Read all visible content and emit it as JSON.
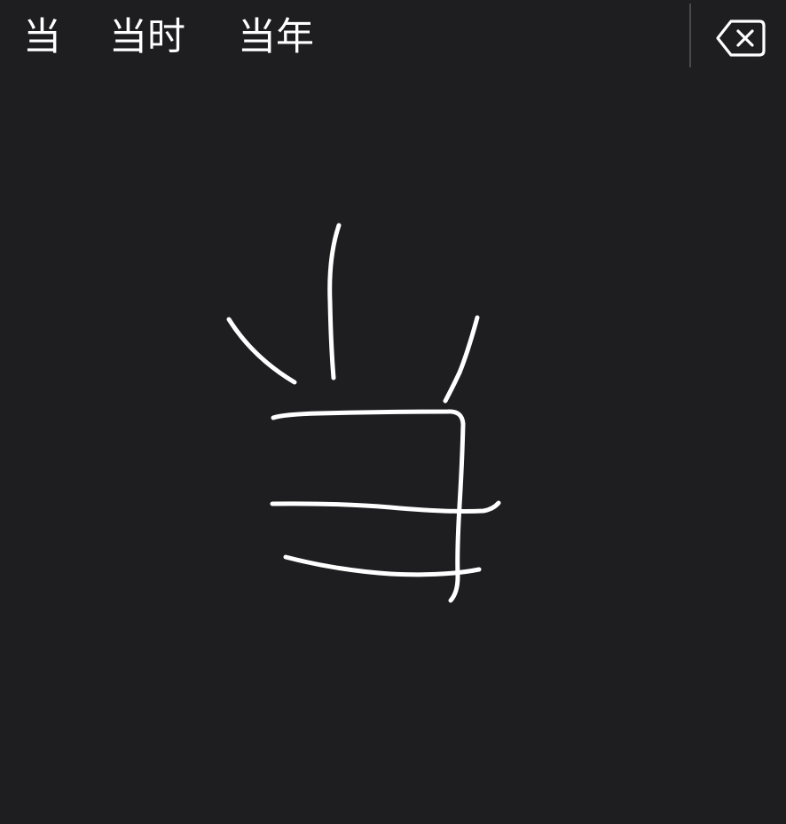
{
  "candidates": [
    "当",
    "当时",
    "当年"
  ],
  "delete_icon": "delete-backward-icon",
  "colors": {
    "background": "#1e1d20",
    "text": "#ffffff",
    "stroke": "#ffffff",
    "divider": "#4a494e"
  }
}
